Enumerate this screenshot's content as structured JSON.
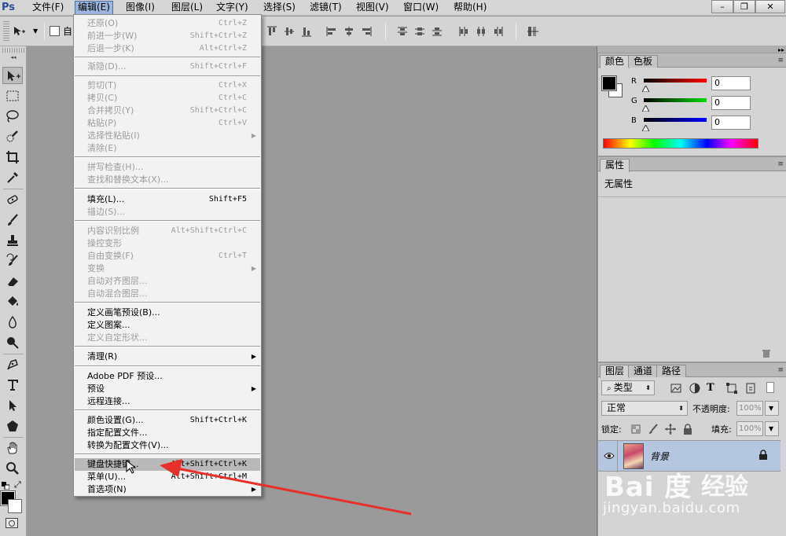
{
  "app": {
    "logo": "Ps"
  },
  "menubar": {
    "items": [
      "文件(F)",
      "编辑(E)",
      "图像(I)",
      "图层(L)",
      "文字(Y)",
      "选择(S)",
      "滤镜(T)",
      "视图(V)",
      "窗口(W)",
      "帮助(H)"
    ],
    "active_index": 1
  },
  "window_controls": {
    "minimize": "–",
    "restore": "❐",
    "close": "✕"
  },
  "optionsbar": {
    "auto_select_label": "自"
  },
  "edit_menu": {
    "items": [
      {
        "label": "还原(O)",
        "shortcut": "Ctrl+Z",
        "enabled": false
      },
      {
        "label": "前进一步(W)",
        "shortcut": "Shift+Ctrl+Z",
        "enabled": false
      },
      {
        "label": "后退一步(K)",
        "shortcut": "Alt+Ctrl+Z",
        "enabled": false
      },
      {
        "label": "渐隐(D)...",
        "shortcut": "Shift+Ctrl+F",
        "enabled": false
      },
      {
        "label": "剪切(T)",
        "shortcut": "Ctrl+X",
        "enabled": false
      },
      {
        "label": "拷贝(C)",
        "shortcut": "Ctrl+C",
        "enabled": false
      },
      {
        "label": "合并拷贝(Y)",
        "shortcut": "Shift+Ctrl+C",
        "enabled": false
      },
      {
        "label": "粘贴(P)",
        "shortcut": "Ctrl+V",
        "enabled": false
      },
      {
        "label": "选择性粘贴(I)",
        "shortcut": "",
        "enabled": false,
        "submenu": true
      },
      {
        "label": "清除(E)",
        "shortcut": "",
        "enabled": false
      },
      {
        "label": "拼写检查(H)...",
        "shortcut": "",
        "enabled": false
      },
      {
        "label": "查找和替换文本(X)...",
        "shortcut": "",
        "enabled": false
      },
      {
        "label": "填充(L)...",
        "shortcut": "Shift+F5",
        "enabled": true
      },
      {
        "label": "描边(S)...",
        "shortcut": "",
        "enabled": false
      },
      {
        "label": "内容识别比例",
        "shortcut": "Alt+Shift+Ctrl+C",
        "enabled": false
      },
      {
        "label": "操控变形",
        "shortcut": "",
        "enabled": false
      },
      {
        "label": "自由变换(F)",
        "shortcut": "Ctrl+T",
        "enabled": false
      },
      {
        "label": "变换",
        "shortcut": "",
        "enabled": false,
        "submenu": true
      },
      {
        "label": "自动对齐图层...",
        "shortcut": "",
        "enabled": false
      },
      {
        "label": "自动混合图层...",
        "shortcut": "",
        "enabled": false
      },
      {
        "label": "定义画笔预设(B)...",
        "shortcut": "",
        "enabled": true
      },
      {
        "label": "定义图案...",
        "shortcut": "",
        "enabled": true
      },
      {
        "label": "定义自定形状...",
        "shortcut": "",
        "enabled": false
      },
      {
        "label": "清理(R)",
        "shortcut": "",
        "enabled": true,
        "submenu": true
      },
      {
        "label": "Adobe PDF 预设...",
        "shortcut": "",
        "enabled": true
      },
      {
        "label": "预设",
        "shortcut": "",
        "enabled": true,
        "submenu": true
      },
      {
        "label": "远程连接...",
        "shortcut": "",
        "enabled": true
      },
      {
        "label": "颜色设置(G)...",
        "shortcut": "Shift+Ctrl+K",
        "enabled": true
      },
      {
        "label": "指定配置文件...",
        "shortcut": "",
        "enabled": true
      },
      {
        "label": "转换为配置文件(V)...",
        "shortcut": "",
        "enabled": true
      },
      {
        "label": "键盘快捷键...",
        "shortcut": "Alt+Shift+Ctrl+K",
        "enabled": true,
        "highlighted": true
      },
      {
        "label": "菜单(U)...",
        "shortcut": "Alt+Shift+Ctrl+M",
        "enabled": true
      },
      {
        "label": "首选项(N)",
        "shortcut": "",
        "enabled": true,
        "submenu": true
      }
    ]
  },
  "color_panel": {
    "tabs": [
      "颜色",
      "色板"
    ],
    "channels": [
      {
        "label": "R",
        "value": "0",
        "color": "#d01010"
      },
      {
        "label": "G",
        "value": "0",
        "color": "#10a020"
      },
      {
        "label": "B",
        "value": "0",
        "color": "#1020c0"
      }
    ]
  },
  "properties_panel": {
    "tab": "属性",
    "content": "无属性"
  },
  "layers_panel": {
    "tabs": [
      "图层",
      "通道",
      "路径"
    ],
    "filter_kind": "类型",
    "blend_mode": "正常",
    "opacity_label": "不透明度:",
    "opacity_value": "100%",
    "lock_label": "锁定:",
    "fill_label": "填充:",
    "fill_value": "100%",
    "layers": [
      {
        "name": "背景",
        "locked": true,
        "visible": true
      }
    ]
  },
  "watermark": {
    "logo": "Bai 度",
    "brand": "经验",
    "url": "jingyan.baidu.com"
  },
  "colors": {
    "menu_highlight": "#b9b9b9",
    "active_menu": "#9db6dd",
    "arrow": "#e8302a",
    "layer_selected": "#b4c6e0"
  }
}
